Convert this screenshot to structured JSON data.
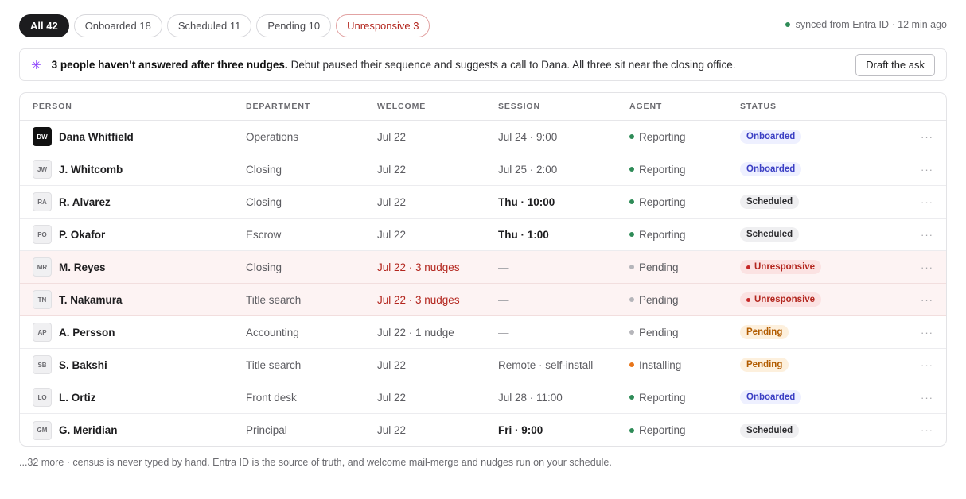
{
  "filters": [
    {
      "label": "All 42"
    },
    {
      "label": "Onboarded 18"
    },
    {
      "label": "Scheduled 11"
    },
    {
      "label": "Pending 10"
    },
    {
      "label": "Unresponsive 3"
    }
  ],
  "sync_status": "synced from Entra ID · 12 min ago",
  "banner": {
    "icon": "sparkle-icon",
    "bold_text": "3 people haven’t answered after three nudges.",
    "text": "Debut paused their sequence and suggests a call to Dana. All three sit near the closing office.",
    "button_label": "Draft the ask"
  },
  "table": {
    "headers": [
      "PERSON",
      "DEPARTMENT",
      "WELCOME",
      "SESSION",
      "AGENT",
      "STATUS"
    ],
    "rows": [
      {
        "initials": "DW",
        "name": "Dana Whitfield",
        "department": "Operations",
        "welcome": "Jul 22",
        "session": "Jul 24 · 9:00",
        "agent": "Reporting",
        "status": "Onboarded",
        "more": "···"
      },
      {
        "initials": "JW",
        "name": "J. Whitcomb",
        "department": "Closing",
        "welcome": "Jul 22",
        "session": "Jul 25 · 2:00",
        "agent": "Reporting",
        "status": "Onboarded",
        "more": "···"
      },
      {
        "initials": "RA",
        "name": "R. Alvarez",
        "department": "Closing",
        "welcome": "Jul 22",
        "session": "Thu · 10:00",
        "agent": "Reporting",
        "status": "Scheduled",
        "more": "···"
      },
      {
        "initials": "PO",
        "name": "P. Okafor",
        "department": "Escrow",
        "welcome": "Jul 22",
        "session": "Thu · 1:00",
        "agent": "Reporting",
        "status": "Scheduled",
        "more": "···"
      },
      {
        "initials": "MR",
        "name": "M. Reyes",
        "department": "Closing",
        "welcome": "Jul 22 · 3 nudges",
        "session": "—",
        "agent": "Pending",
        "status": "Unresponsive",
        "more": "···"
      },
      {
        "initials": "TN",
        "name": "T. Nakamura",
        "department": "Title search",
        "welcome": "Jul 22 · 3 nudges",
        "session": "—",
        "agent": "Pending",
        "status": "Unresponsive",
        "more": "···"
      },
      {
        "initials": "AP",
        "name": "A. Persson",
        "department": "Accounting",
        "welcome": "Jul 22 · 1 nudge",
        "session": "—",
        "agent": "Pending",
        "status": "Pending",
        "more": "···"
      },
      {
        "initials": "SB",
        "name": "S. Bakshi",
        "department": "Title search",
        "welcome": "Jul 22",
        "session": "Remote · self-install",
        "agent": "Installing",
        "status": "Pending",
        "more": "···"
      },
      {
        "initials": "LO",
        "name": "L. Ortiz",
        "department": "Front desk",
        "welcome": "Jul 22",
        "session": "Jul 28 · 11:00",
        "agent": "Reporting",
        "status": "Onboarded",
        "more": "···"
      },
      {
        "initials": "GM",
        "name": "G. Meridian",
        "department": "Principal",
        "welcome": "Jul 22",
        "session": "Fri · 9:00",
        "agent": "Reporting",
        "status": "Scheduled",
        "more": "···"
      }
    ]
  },
  "footer": "...32 more · census is never typed by hand. Entra ID is the source of truth, and welcome mail-merge and nudges run on your schedule.",
  "colors": {
    "accent_dark": "#1c1c1e",
    "alert_red": "#b3261e",
    "onboarded_blue": "#3b3fc4",
    "pending_orange": "#b25c00",
    "sync_green": "#2e8b57"
  }
}
